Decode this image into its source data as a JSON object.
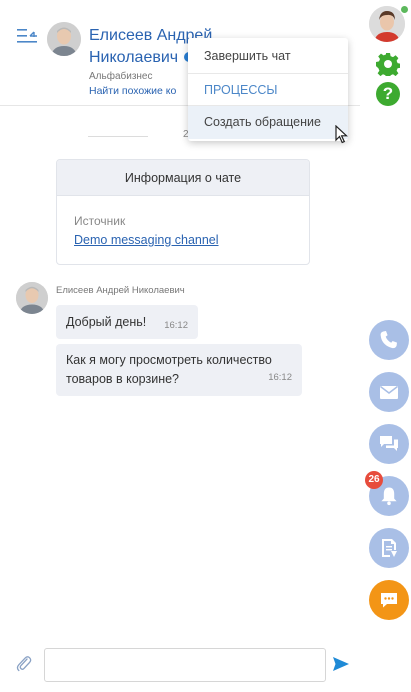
{
  "header": {
    "contact_name": "Елисеев Андрей Николаевич",
    "company": "Альфабизнес",
    "similar_link": "Найти похожие ко"
  },
  "menu": {
    "items": [
      {
        "label": "Завершить чат"
      },
      {
        "label": "ПРОЦЕССЫ"
      },
      {
        "label": "Создать обращение"
      }
    ]
  },
  "chat": {
    "date": "20.10.2020",
    "info_card": {
      "title": "Информация о чате",
      "source_label": "Источник",
      "source_value": "Demo messaging channel"
    },
    "author": "Елисеев Андрей Николаевич",
    "messages": [
      {
        "text": "Добрый день!",
        "time": "16:12"
      },
      {
        "text": "Как я могу просмотреть количество товаров в корзине?",
        "time": "16:12"
      }
    ]
  },
  "input": {
    "value": ""
  },
  "rail": {
    "notification_count": "26"
  },
  "icons": {
    "collapse": "collapse-panel-icon",
    "attach": "paperclip-icon",
    "send": "send-icon",
    "gear": "gear-icon",
    "help": "help-icon",
    "phone": "phone-icon",
    "mail": "mail-icon",
    "chats": "chats-icon",
    "bell": "bell-icon",
    "document": "document-icon",
    "chat_bubble": "chat-bubble-icon"
  },
  "colors": {
    "link": "#2a63b1",
    "rail_button": "#a9bfe6",
    "active_chat_button": "#f39516",
    "help_green": "#3daa30",
    "badge_red": "#e74c3c",
    "send_blue": "#1f8ad6"
  }
}
